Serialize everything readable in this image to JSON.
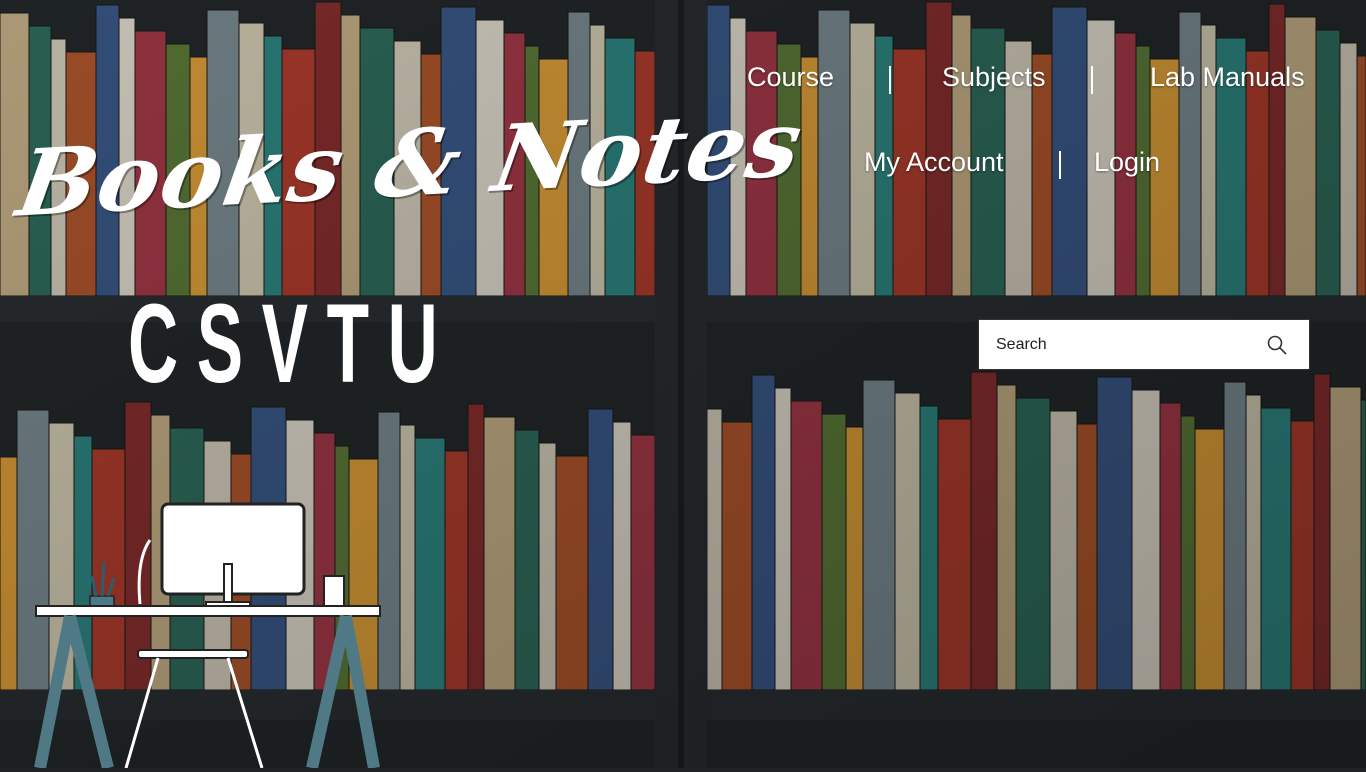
{
  "logo": {
    "script_text": "Books & Notes",
    "subtitle_text": "CSVTU"
  },
  "nav": {
    "course": "Course",
    "subjects": "Subjects",
    "lab_manuals": "Lab Manuals",
    "my_account": "My Account",
    "login": "Login"
  },
  "search": {
    "placeholder": "Search",
    "value": ""
  },
  "icons": {
    "search": "search-icon",
    "desk": "desk-illustration"
  },
  "colors": {
    "text": "#ffffff",
    "search_bg": "#ffffff",
    "shelf": "#2a2f32"
  }
}
